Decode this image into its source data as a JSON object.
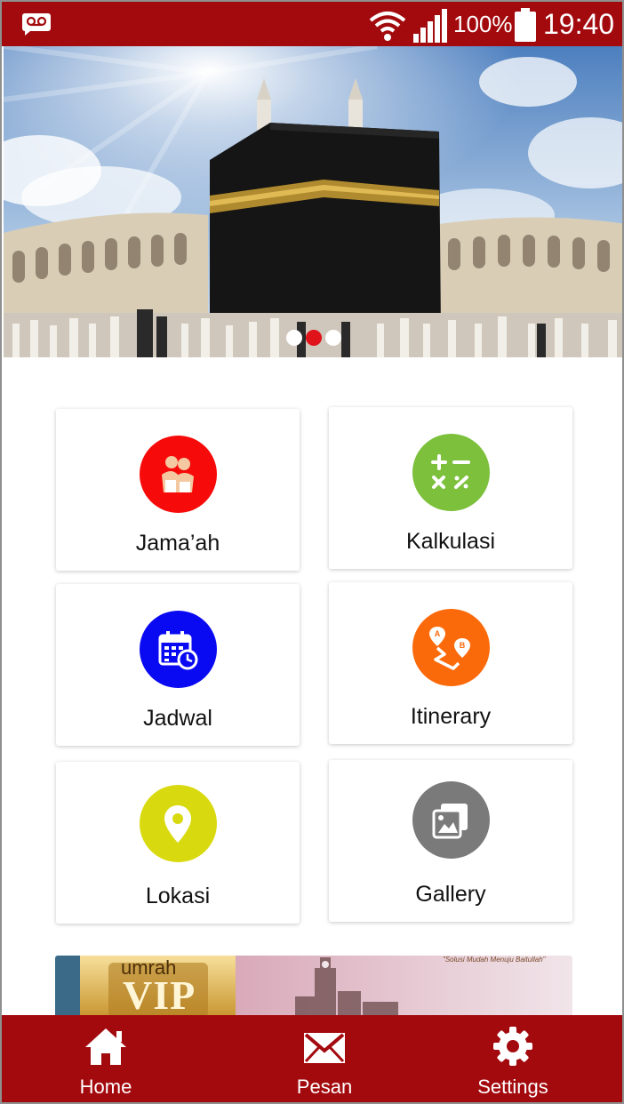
{
  "status_bar": {
    "battery_percent": "100%",
    "time": "19:40",
    "icons": [
      "voicemail-icon",
      "wifi-icon",
      "signal-icon",
      "battery-icon"
    ]
  },
  "hero": {
    "image": "kaaba-photo",
    "carousel_total": 3,
    "carousel_active": 2
  },
  "menu": {
    "items": [
      {
        "label": "Jama’ah",
        "icon": "pilgrims-icon",
        "color": "#f70a0a"
      },
      {
        "label": "Kalkulasi",
        "icon": "calculator-icon",
        "color": "#7cc03b"
      },
      {
        "label": "Jadwal",
        "icon": "calendar-icon",
        "color": "#0a0af2"
      },
      {
        "label": "Itinerary",
        "icon": "route-icon",
        "color": "#fb6a0a"
      },
      {
        "label": "Lokasi",
        "icon": "location-pin-icon",
        "color": "#d9d90f"
      },
      {
        "label": "Gallery",
        "icon": "gallery-icon",
        "color": "#7a7a7a"
      }
    ]
  },
  "promo": {
    "badge_top": "umrah",
    "badge_main": "VIP",
    "tagline": "\"Solusi Mudah Menuju Baitullah\""
  },
  "bottom_nav": {
    "items": [
      {
        "label": "Home",
        "icon": "home-icon"
      },
      {
        "label": "Pesan",
        "icon": "mail-icon"
      },
      {
        "label": "Settings",
        "icon": "gear-icon"
      }
    ]
  },
  "colors": {
    "primary": "#a30a0e",
    "carousel_active": "#e0121a"
  }
}
